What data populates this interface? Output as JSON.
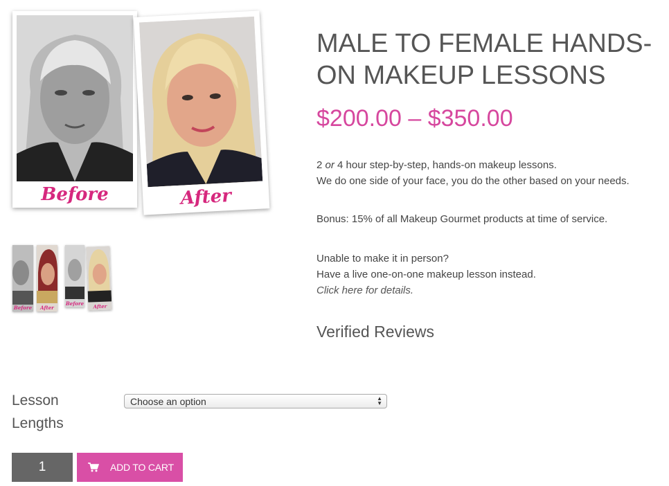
{
  "gallery": {
    "main_image": {
      "before_caption": "Before",
      "after_caption": "After"
    },
    "thumbnails": [
      {
        "caption": "Before"
      },
      {
        "caption": "After"
      },
      {
        "caption": "Before"
      },
      {
        "caption": "After"
      }
    ]
  },
  "product": {
    "title": "MALE TO FEMALE HANDS-ON MAKEUP LESSONS",
    "price": "$200.00 – $350.00",
    "description": {
      "line1_part1": "2",
      "line1_em": "or",
      "line1_part2": "4 hour step-by-step, hands-on makeup lessons.",
      "line2": "We do one side of your face, you do the other based on your needs.",
      "bonus": "Bonus: 15% of all Makeup Gourmet products at time of service.",
      "remote1": "Unable to make it in person?",
      "remote2": "Have a live one-on-one makeup lesson instead.",
      "details_link": "Click here for details."
    },
    "reviews_heading": "Verified Reviews"
  },
  "variations": {
    "label": "Lesson Lengths",
    "select_value": "Choose an option"
  },
  "cart": {
    "quantity": "1",
    "add_label": "ADD TO CART"
  },
  "colors": {
    "accent": "#d94fa6",
    "price": "#d6479e",
    "caption": "#d6287e",
    "qty_bg": "#666666"
  }
}
